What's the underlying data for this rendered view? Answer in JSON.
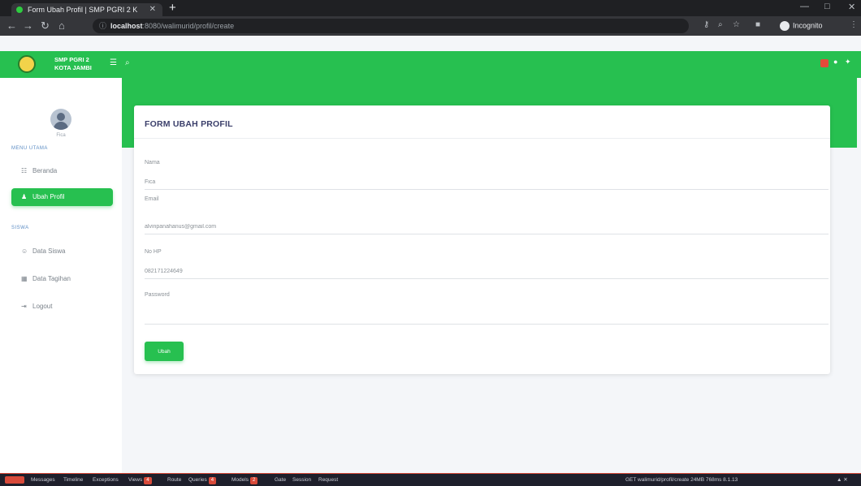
{
  "browser": {
    "tab_title": "Form Ubah Profil | SMP PGRI 2 K",
    "address_host": "localhost",
    "address_path": ":8080/walimurid/profil/create",
    "incognito_label": "Incognito"
  },
  "app": {
    "brand_line1": "SMP PGRI 2",
    "brand_line2": "KOTA JAMBI"
  },
  "sidebar": {
    "user_name": "Fica",
    "section_main": "MENU UTAMA",
    "items_main": [
      {
        "label": "Beranda",
        "icon": "grid-icon"
      },
      {
        "label": "Ubah Profil",
        "icon": "user-icon",
        "active": true
      }
    ],
    "section_siswa": "SISWA",
    "items_siswa": [
      {
        "label": "Data Siswa",
        "icon": "users-icon"
      },
      {
        "label": "Data Tagihan",
        "icon": "calendar-icon"
      },
      {
        "label": "Logout",
        "icon": "logout-icon"
      }
    ]
  },
  "form": {
    "title": "FORM UBAH PROFIL",
    "name_label": "Nama",
    "name_value": "Fica",
    "email_label": "Email",
    "email_value": "alvinpanahanus@gmail.com",
    "phone_label": "No HP",
    "phone_value": "082171224649",
    "password_label": "Password",
    "password_value": "",
    "submit_label": "Ubah"
  },
  "debugbar": {
    "tabs": [
      "Messages",
      "Timeline",
      "Exceptions",
      "Views",
      "Route",
      "Queries",
      "Models",
      "Gate",
      "Session",
      "Request"
    ],
    "views_count": "4",
    "queries_count": "4",
    "models_count": "2",
    "right_text": "GET walimurid/profil/create  24MB  768ms  8.1.13"
  },
  "colors": {
    "accent": "#27c050",
    "title": "#3b3f6b"
  }
}
